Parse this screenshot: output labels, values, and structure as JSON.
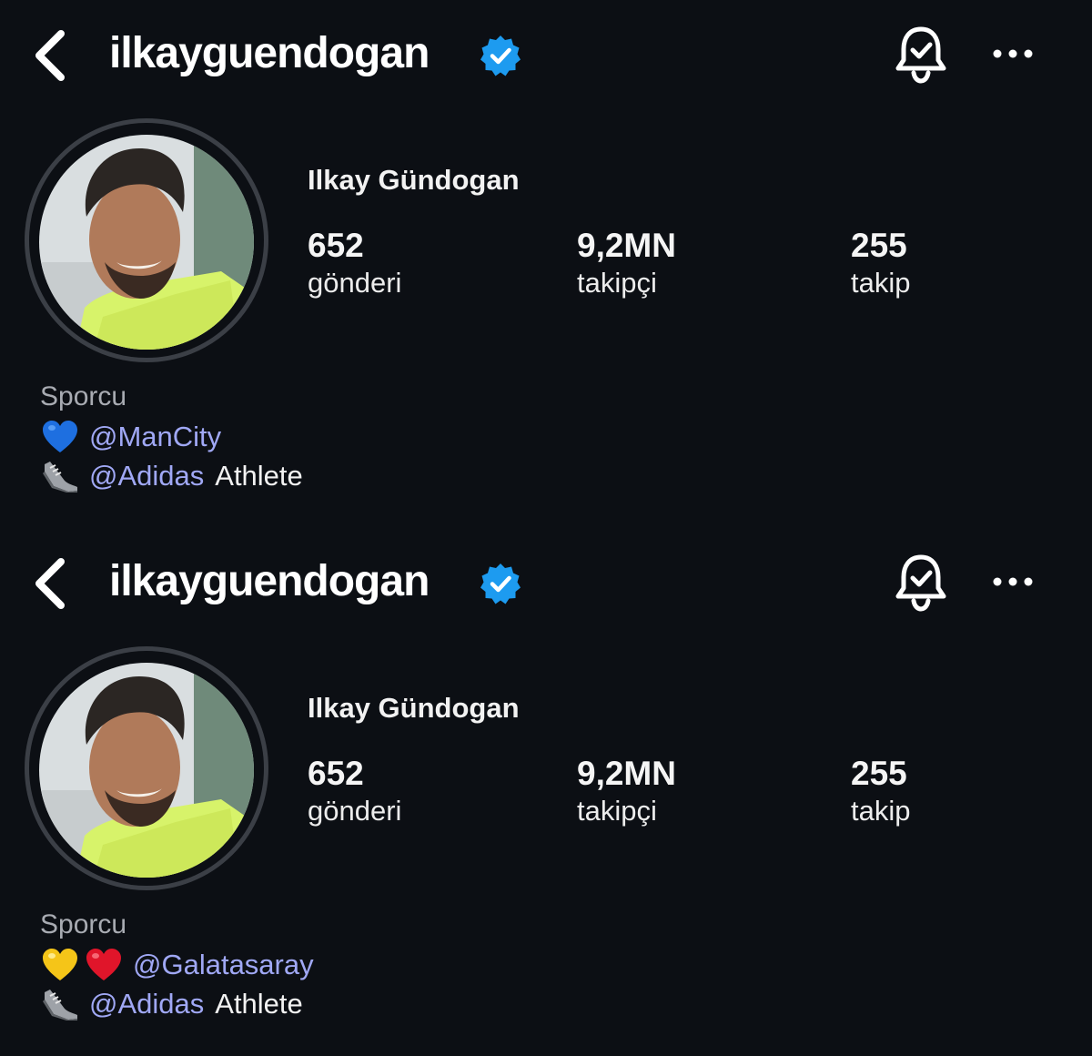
{
  "colors": {
    "background": "#0c0f14",
    "verified_badge": "#1d9bf0",
    "mention_link": "#a0a8f5",
    "category_text": "#a8abb2",
    "avatar_ring": "#3b3f46"
  },
  "profiles": [
    {
      "header": {
        "back_icon": "chevron-left-icon",
        "username": "ilkayguendogan",
        "verified_icon": "verified-badge-icon",
        "bell_icon": "bell-check-icon",
        "more_icon": "more-horizontal-icon"
      },
      "display_name": "Ilkay Gündogan",
      "stats": [
        {
          "value": "652",
          "label": "gönderi"
        },
        {
          "value": "9,2MN",
          "label": "takipçi"
        },
        {
          "value": "255",
          "label": "takip"
        }
      ],
      "category": "Sporcu",
      "bio": [
        {
          "emojis": [
            "blue-heart-icon"
          ],
          "mention": "@ManCity",
          "text": ""
        },
        {
          "emojis": [
            "sneaker-icon"
          ],
          "mention": "@Adidas",
          "text": "Athlete"
        }
      ]
    },
    {
      "header": {
        "back_icon": "chevron-left-icon",
        "username": "ilkayguendogan",
        "verified_icon": "verified-badge-icon",
        "bell_icon": "bell-check-icon",
        "more_icon": "more-horizontal-icon"
      },
      "display_name": "Ilkay Gündogan",
      "stats": [
        {
          "value": "652",
          "label": "gönderi"
        },
        {
          "value": "9,2MN",
          "label": "takipçi"
        },
        {
          "value": "255",
          "label": "takip"
        }
      ],
      "category": "Sporcu",
      "bio": [
        {
          "emojis": [
            "yellow-heart-icon",
            "red-heart-icon"
          ],
          "mention": "@Galatasaray",
          "text": ""
        },
        {
          "emojis": [
            "sneaker-icon"
          ],
          "mention": "@Adidas",
          "text": "Athlete"
        }
      ]
    }
  ]
}
